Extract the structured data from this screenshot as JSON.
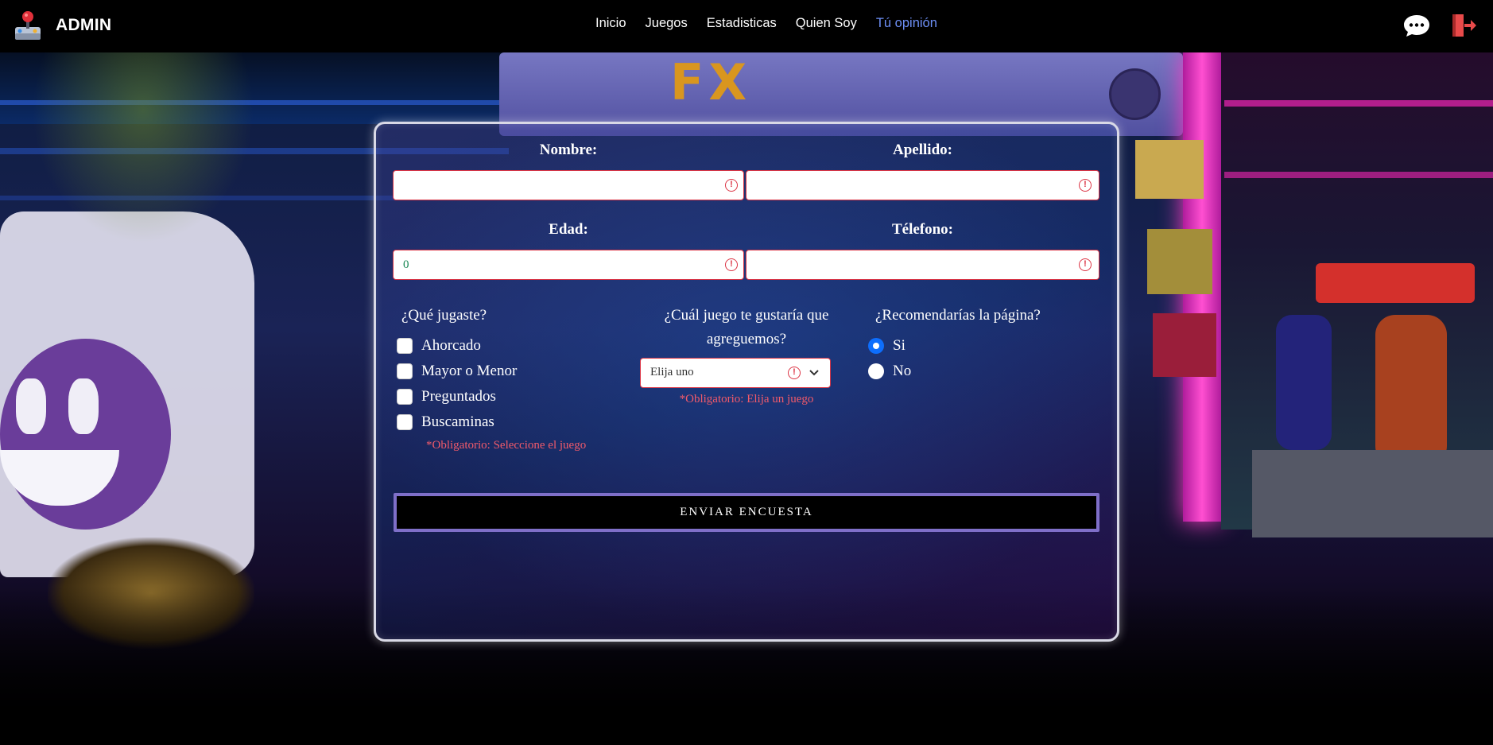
{
  "navbar": {
    "brand": "ADMIN",
    "links": [
      {
        "label": "Inicio"
      },
      {
        "label": "Juegos"
      },
      {
        "label": "Estadisticas"
      },
      {
        "label": "Quien Soy"
      },
      {
        "label": "Tú opinión"
      }
    ],
    "active_index": 4,
    "icons": [
      "chat-icon",
      "logout-icon"
    ]
  },
  "form": {
    "nombre_label": "Nombre:",
    "apellido_label": "Apellido:",
    "edad_label": "Edad:",
    "telefono_label": "Télefono:",
    "nombre_value": "",
    "apellido_value": "",
    "edad_value": "0",
    "telefono_value": "",
    "played_title": "¿Qué jugaste?",
    "games": [
      "Ahorcado",
      "Mayor o Menor",
      "Preguntados",
      "Buscaminas"
    ],
    "played_error": "*Obligatorio: Seleccione el juego",
    "add_game_title_line1": "¿Cuál juego te gustaría que",
    "add_game_title_line2": "agreguemos?",
    "select_value": "Elija uno",
    "select_error": "*Obligatorio: Elija un juego",
    "recommend_title": "¿Recomendarías la página?",
    "recommend_options": [
      "Si",
      "No"
    ],
    "recommend_selected": "Si",
    "submit_label": "ENVIAR ENCUESTA"
  },
  "colors": {
    "active_link": "#6d8ff6",
    "error": "#dc3545",
    "submit_border": "#7f6fc9"
  }
}
